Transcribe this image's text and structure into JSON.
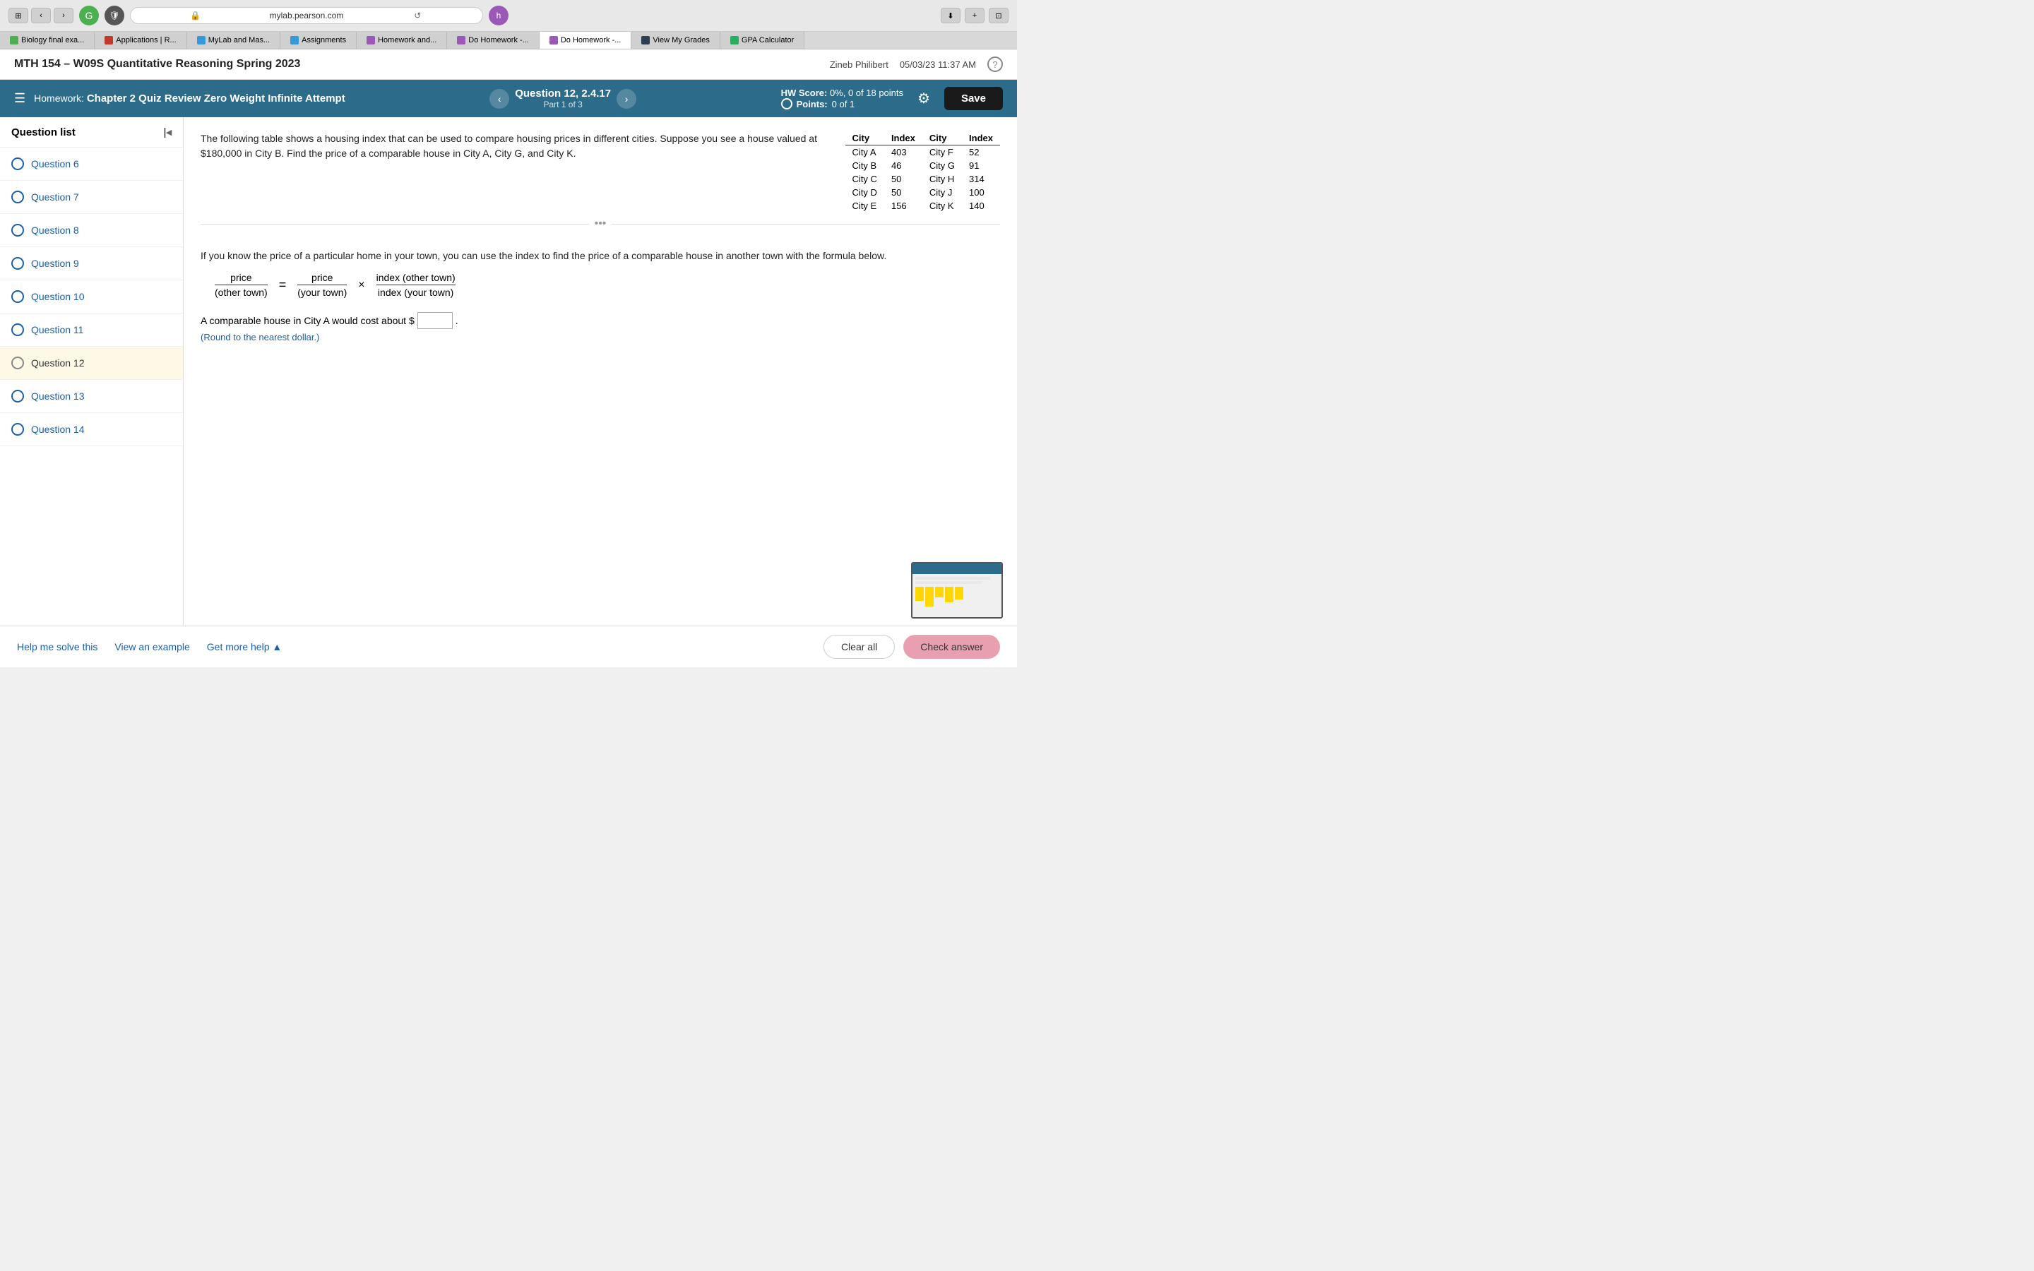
{
  "browser": {
    "address": "mylab.pearson.com",
    "tabs": [
      {
        "label": "Biology final exa...",
        "icon_color": "#4CAF50",
        "active": false
      },
      {
        "label": "Applications | R...",
        "icon_color": "#c0392b",
        "active": false
      },
      {
        "label": "MyLab and Mas...",
        "icon_color": "#3498db",
        "active": false
      },
      {
        "label": "Assignments",
        "icon_color": "#3498db",
        "active": false
      },
      {
        "label": "Homework and...",
        "icon_color": "#9b59b6",
        "active": false
      },
      {
        "label": "Do Homework -...",
        "icon_color": "#9b59b6",
        "active": false
      },
      {
        "label": "Do Homework -...",
        "icon_color": "#9b59b6",
        "active": true
      },
      {
        "label": "View My Grades",
        "icon_color": "#2c3e50",
        "active": false
      },
      {
        "label": "GPA Calculator",
        "icon_color": "#27ae60",
        "active": false
      }
    ]
  },
  "app_header": {
    "title": "MTH 154 – W09S Quantitative Reasoning Spring 2023",
    "user": "Zineb Philibert",
    "datetime": "05/03/23 11:37 AM",
    "help_icon": "?"
  },
  "hw_bar": {
    "homework_label": "Homework:",
    "hw_title": "Chapter 2 Quiz Review Zero Weight Infinite Attempt",
    "question_num": "Question 12, 2.4.17",
    "question_part": "Part 1 of 3",
    "hw_score_label": "HW Score:",
    "hw_score_value": "0%, 0 of 18 points",
    "points_label": "Points:",
    "points_value": "0 of 1",
    "save_btn": "Save"
  },
  "sidebar": {
    "title": "Question list",
    "questions": [
      {
        "id": 6,
        "label": "Question 6",
        "active": false
      },
      {
        "id": 7,
        "label": "Question 7",
        "active": false
      },
      {
        "id": 8,
        "label": "Question 8",
        "active": false
      },
      {
        "id": 9,
        "label": "Question 9",
        "active": false
      },
      {
        "id": 10,
        "label": "Question 10",
        "active": false
      },
      {
        "id": 11,
        "label": "Question 11",
        "active": false
      },
      {
        "id": 12,
        "label": "Question 12",
        "active": true
      },
      {
        "id": 13,
        "label": "Question 13",
        "active": false
      },
      {
        "id": 14,
        "label": "Question 14",
        "active": false
      }
    ]
  },
  "problem": {
    "intro": "The following table shows a housing index that can be used to compare housing prices in different cities.  Suppose you see a house valued at $180,000 in City B. Find the price of a comparable house in City A, City G, and City K.",
    "table": {
      "columns": [
        "City",
        "Index",
        "City",
        "Index"
      ],
      "rows": [
        [
          "City A",
          "403",
          "City F",
          "52"
        ],
        [
          "City B",
          "46",
          "City G",
          "91"
        ],
        [
          "City C",
          "50",
          "City H",
          "314"
        ],
        [
          "City D",
          "50",
          "City J",
          "100"
        ],
        [
          "City E",
          "156",
          "City K",
          "140"
        ]
      ]
    },
    "formula_intro": "If you know the price of a particular home in your town, you can use the index to find the price of a comparable house in another town with the formula below.",
    "formula": {
      "lhs_num": "price",
      "lhs_den": "(other town)",
      "equals": "=",
      "rhs_num": "price",
      "rhs_den": "(your town)",
      "times": "×",
      "frac_num": "index (other town)",
      "frac_den": "index (your town)"
    },
    "answer_prefix": "A comparable house in City A would cost about $",
    "answer_suffix": ".",
    "answer_hint": "(Round to the nearest dollar.)",
    "answer_placeholder": ""
  },
  "bottom_bar": {
    "help_me": "Help me solve this",
    "view_example": "View an example",
    "get_more_help": "Get more help ▲",
    "clear_all": "Clear all",
    "check_answer": "Check answer"
  }
}
